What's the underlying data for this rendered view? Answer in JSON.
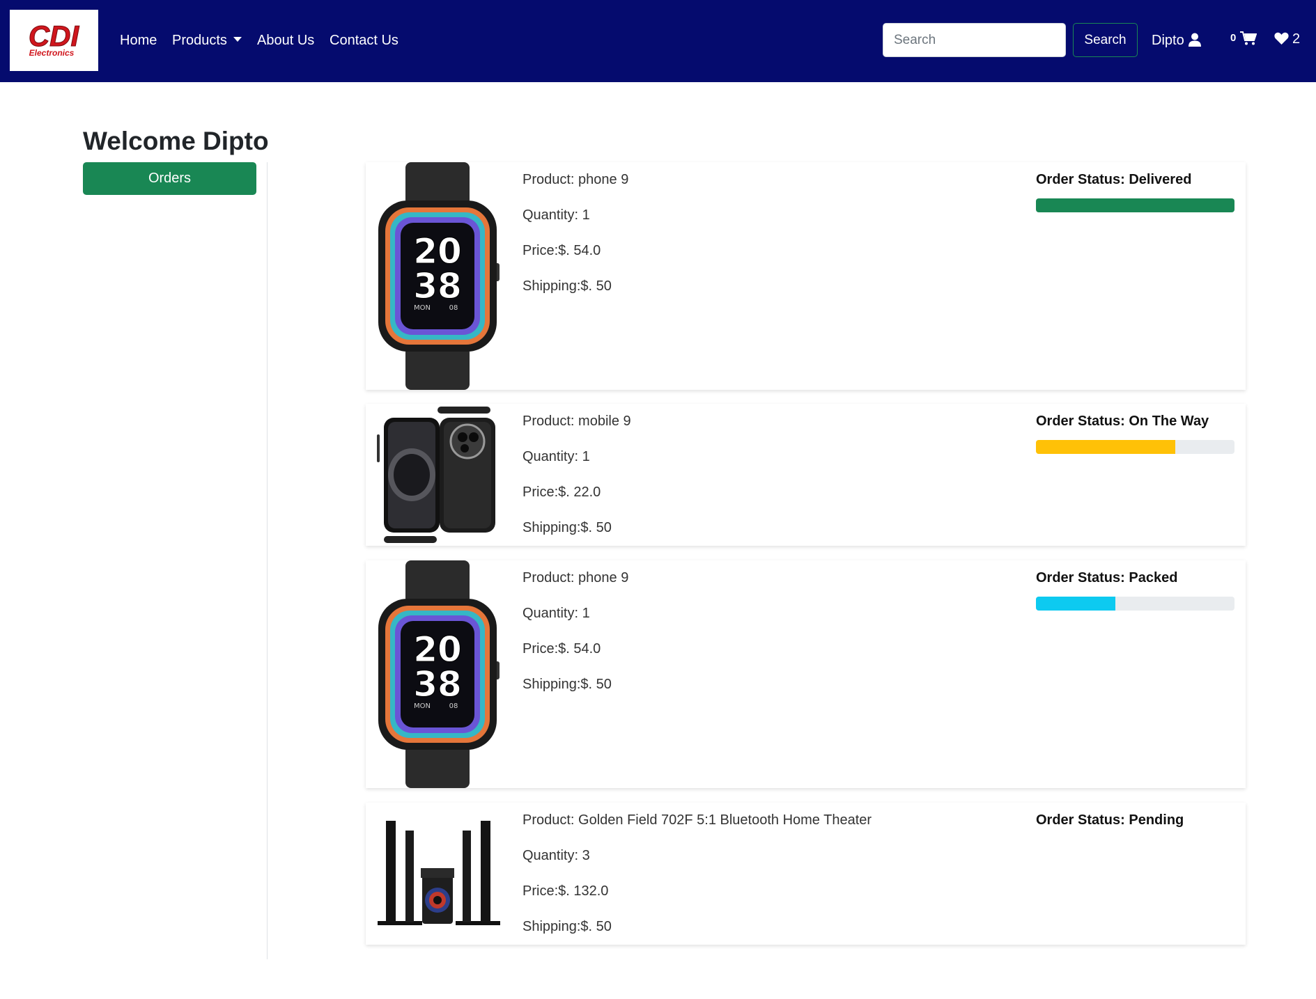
{
  "navbar": {
    "logo_text": "CDI",
    "logo_subtext": "Electronics",
    "links": {
      "home": "Home",
      "products": "Products",
      "about": "About Us",
      "contact": "Contact Us"
    },
    "search": {
      "placeholder": "Search",
      "button_label": "Search"
    },
    "user_name": "Dipto",
    "cart_count": "0",
    "wishlist_count": "2"
  },
  "sidebar": {
    "welcome": "Welcome Dipto",
    "orders_label": "Orders"
  },
  "orders": [
    {
      "product": "Product: phone 9",
      "quantity": "Quantity: 1",
      "price": "Price:$. 54.0",
      "shipping": "Shipping:$. 50",
      "status": "Order Status: Delivered",
      "progress": 1.0,
      "progress_color": "#198754",
      "image": "smartwatch-image"
    },
    {
      "product": "Product: mobile 9",
      "quantity": "Quantity: 1",
      "price": "Price:$. 22.0",
      "shipping": "Shipping:$. 50",
      "status": "Order Status: On The Way",
      "progress": 0.7,
      "progress_color": "#ffc107",
      "image": "smartphone-image"
    },
    {
      "product": "Product: phone 9",
      "quantity": "Quantity: 1",
      "price": "Price:$. 54.0",
      "shipping": "Shipping:$. 50",
      "status": "Order Status: Packed",
      "progress": 0.4,
      "progress_color": "#0dcaf0",
      "image": "smartwatch-image"
    },
    {
      "product": "Product: Golden Field 702F 5:1 Bluetooth Home Theater",
      "quantity": "Quantity: 3",
      "price": "Price:$. 132.0",
      "shipping": "Shipping:$. 50",
      "status": "Order Status: Pending",
      "progress": 0,
      "progress_color": "#0d6efd",
      "image": "home-theater-image"
    }
  ]
}
